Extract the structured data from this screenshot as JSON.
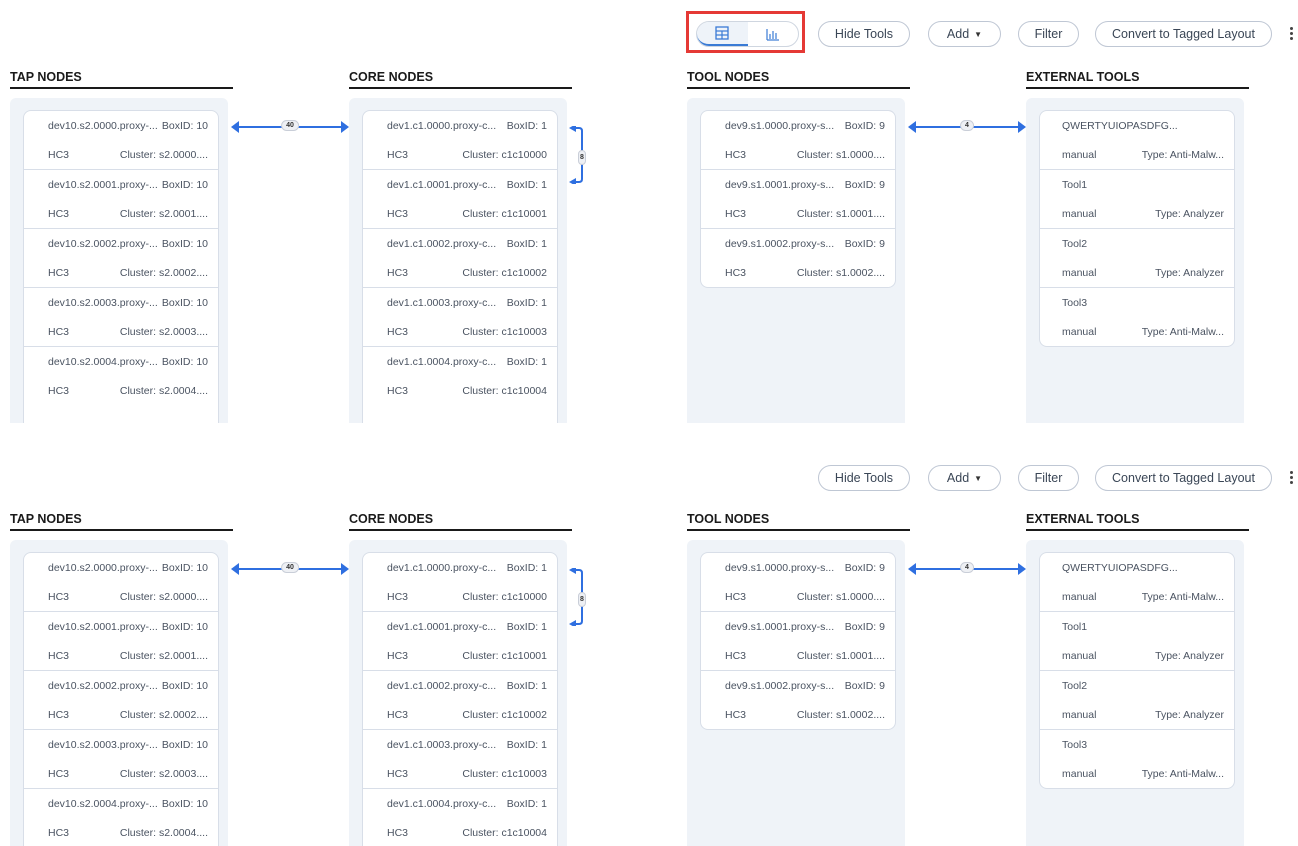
{
  "toolbar": {
    "hide_tools": "Hide Tools",
    "add": "Add",
    "filter": "Filter",
    "convert": "Convert to Tagged Layout"
  },
  "sections": {
    "tap": "TAP NODES",
    "core": "CORE NODES",
    "tool": "TOOL NODES",
    "external": "EXTERNAL TOOLS"
  },
  "links": {
    "tap_core": "40",
    "core_loop": "8",
    "tool_external": "4"
  },
  "tap_nodes": [
    {
      "name": "dev10.s2.0000.proxy-...",
      "boxid": "BoxID: 10",
      "type": "HC3",
      "cluster": "Cluster: s2.0000...."
    },
    {
      "name": "dev10.s2.0001.proxy-...",
      "boxid": "BoxID: 10",
      "type": "HC3",
      "cluster": "Cluster: s2.0001...."
    },
    {
      "name": "dev10.s2.0002.proxy-...",
      "boxid": "BoxID: 10",
      "type": "HC3",
      "cluster": "Cluster: s2.0002...."
    },
    {
      "name": "dev10.s2.0003.proxy-...",
      "boxid": "BoxID: 10",
      "type": "HC3",
      "cluster": "Cluster: s2.0003...."
    },
    {
      "name": "dev10.s2.0004.proxy-...",
      "boxid": "BoxID: 10",
      "type": "HC3",
      "cluster": "Cluster: s2.0004...."
    }
  ],
  "core_nodes": [
    {
      "name": "dev1.c1.0000.proxy-c...",
      "boxid": "BoxID: 1",
      "type": "HC3",
      "cluster": "Cluster: c1c10000"
    },
    {
      "name": "dev1.c1.0001.proxy-c...",
      "boxid": "BoxID: 1",
      "type": "HC3",
      "cluster": "Cluster: c1c10001"
    },
    {
      "name": "dev1.c1.0002.proxy-c...",
      "boxid": "BoxID: 1",
      "type": "HC3",
      "cluster": "Cluster: c1c10002"
    },
    {
      "name": "dev1.c1.0003.proxy-c...",
      "boxid": "BoxID: 1",
      "type": "HC3",
      "cluster": "Cluster: c1c10003"
    },
    {
      "name": "dev1.c1.0004.proxy-c...",
      "boxid": "BoxID: 1",
      "type": "HC3",
      "cluster": "Cluster: c1c10004"
    }
  ],
  "tool_nodes": [
    {
      "name": "dev9.s1.0000.proxy-s...",
      "boxid": "BoxID: 9",
      "type": "HC3",
      "cluster": "Cluster: s1.0000...."
    },
    {
      "name": "dev9.s1.0001.proxy-s...",
      "boxid": "BoxID: 9",
      "type": "HC3",
      "cluster": "Cluster: s1.0001...."
    },
    {
      "name": "dev9.s1.0002.proxy-s...",
      "boxid": "BoxID: 9",
      "type": "HC3",
      "cluster": "Cluster: s1.0002...."
    }
  ],
  "external_tools": [
    {
      "name": "QWERTYUIOPASDFG...",
      "mode": "manual",
      "type": "Type: Anti-Malw..."
    },
    {
      "name": "Tool1",
      "mode": "manual",
      "type": "Type: Analyzer"
    },
    {
      "name": "Tool2",
      "mode": "manual",
      "type": "Type: Analyzer"
    },
    {
      "name": "Tool3",
      "mode": "manual",
      "type": "Type: Anti-Malw..."
    }
  ],
  "icons": {
    "table_view": "table-view-icon",
    "chart_view": "bar-chart-icon"
  },
  "colors": {
    "link": "#2f6fe0",
    "highlight": "#e53935",
    "group_bg": "#eff3f8"
  }
}
